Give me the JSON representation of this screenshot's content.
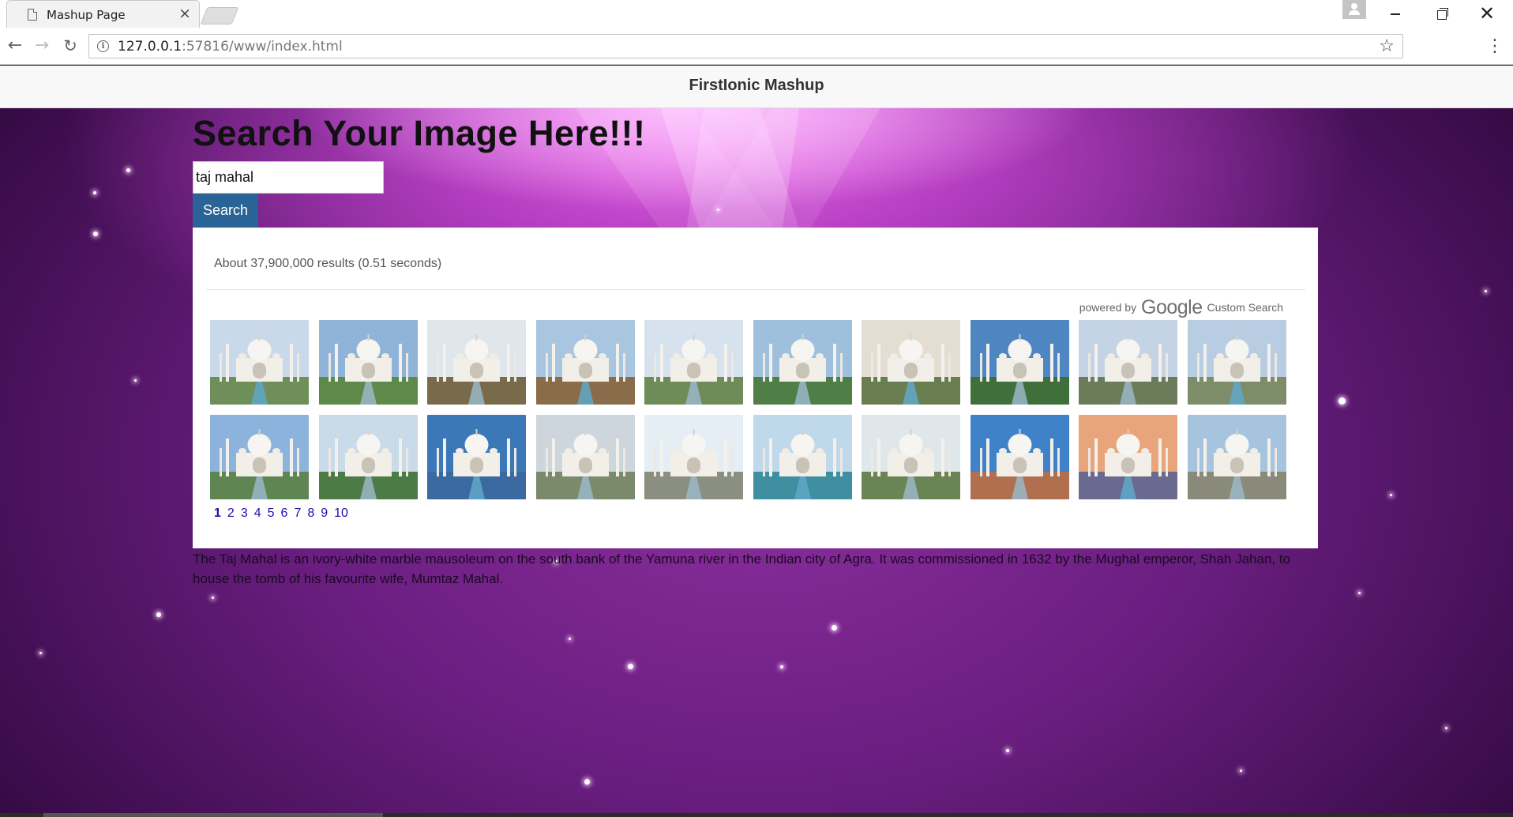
{
  "browser": {
    "tab_title": "Mashup Page",
    "tab_close": "×",
    "url_host": "127.0.0.1",
    "url_path": ":57816/www/index.html",
    "back_icon": "←",
    "forward_icon": "→",
    "reload_icon": "↻",
    "star_icon": "☆",
    "menu_icon": "⋮",
    "close_icon": "✕"
  },
  "header": {
    "title": "FirstIonic Mashup"
  },
  "main": {
    "heading": "Search Your Image Here!!!",
    "search_value": "taj mahal",
    "search_button": "Search"
  },
  "results": {
    "count_text": "About 37,900,000 results (0.51 seconds)",
    "powered_by": "powered by",
    "google": "Google",
    "custom_search": "Custom Search",
    "pages": [
      "1",
      "2",
      "3",
      "4",
      "5",
      "6",
      "7",
      "8",
      "9",
      "10"
    ]
  },
  "description": "The Taj Mahal is an ivory-white marble mausoleum on the south bank of the Yamuna river in the Indian city of Agra. It was commissioned in 1632 by the Mughal emperor, Shah Jahan, to house the tomb of his favourite wife, Mumtaz Mahal."
}
